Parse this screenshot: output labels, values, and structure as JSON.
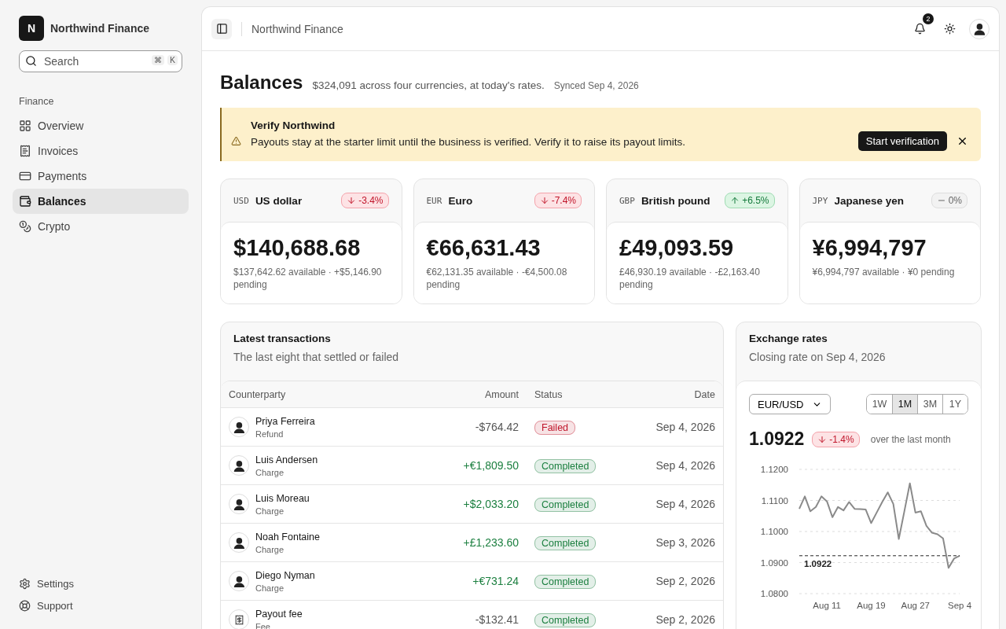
{
  "sidebar": {
    "brand": {
      "initial": "N",
      "name": "Northwind Finance"
    },
    "search": {
      "placeholder": "Search",
      "keys": [
        "⌘",
        "K"
      ]
    },
    "section": "Finance",
    "items": [
      {
        "label": "Overview",
        "selected": false
      },
      {
        "label": "Invoices",
        "selected": false
      },
      {
        "label": "Payments",
        "selected": false
      },
      {
        "label": "Balances",
        "selected": true
      },
      {
        "label": "Crypto",
        "selected": false
      }
    ],
    "footer": [
      {
        "label": "Settings"
      },
      {
        "label": "Support"
      }
    ]
  },
  "topbar": {
    "title": "Northwind Finance",
    "notifications": "2"
  },
  "page": {
    "title": "Balances",
    "summary": "$324,091 across four currencies, at today's rates.",
    "synced": "Synced Sep 4, 2026"
  },
  "alert": {
    "title": "Verify Northwind",
    "message": "Payouts stay at the starter limit until the business is verified. Verify it to raise its payout limits.",
    "action": "Start verification"
  },
  "balances": [
    {
      "code": "USD",
      "name": "US dollar",
      "change": {
        "label": "-3.4%",
        "kind": "down"
      },
      "amount": "$140,688.68",
      "detail": "$137,642.62 available · +$5,146.90 pending"
    },
    {
      "code": "EUR",
      "name": "Euro",
      "change": {
        "label": "-7.4%",
        "kind": "down"
      },
      "amount": "€66,631.43",
      "detail": "€62,131.35 available · -€4,500.08 pending"
    },
    {
      "code": "GBP",
      "name": "British pound",
      "change": {
        "label": "+6.5%",
        "kind": "up"
      },
      "amount": "£49,093.59",
      "detail": "£46,930.19 available · -£2,163.40 pending"
    },
    {
      "code": "JPY",
      "name": "Japanese yen",
      "change": {
        "label": "0%",
        "kind": "flat"
      },
      "amount": "¥6,994,797",
      "detail": "¥6,994,797 available · ¥0 pending"
    }
  ],
  "transactions": {
    "title": "Latest transactions",
    "subtitle": "The last eight that settled or failed",
    "columns": [
      "Counterparty",
      "Amount",
      "Status",
      "Date"
    ],
    "rows": [
      {
        "kind": "refund",
        "name": "Priya Ferreira",
        "type": "Refund",
        "amount": "-$764.42",
        "status": {
          "label": "Failed",
          "color": "#c0162b"
        },
        "date": "Sep 4, 2026"
      },
      {
        "kind": "charge",
        "name": "Luis Andersen",
        "type": "Charge",
        "amount": "+€1,809.50",
        "status": {
          "label": "Completed",
          "color": "#1b7f3f"
        },
        "date": "Sep 4, 2026"
      },
      {
        "kind": "charge",
        "name": "Luis Moreau",
        "type": "Charge",
        "amount": "+$2,033.20",
        "status": {
          "label": "Completed",
          "color": "#1b7f3f"
        },
        "date": "Sep 4, 2026"
      },
      {
        "kind": "charge",
        "name": "Noah Fontaine",
        "type": "Charge",
        "amount": "+£1,233.60",
        "status": {
          "label": "Completed",
          "color": "#1b7f3f"
        },
        "date": "Sep 3, 2026"
      },
      {
        "kind": "charge",
        "name": "Diego Nyman",
        "type": "Charge",
        "amount": "+€731.24",
        "status": {
          "label": "Completed",
          "color": "#1b7f3f"
        },
        "date": "Sep 2, 2026"
      },
      {
        "kind": "fee",
        "name": "Payout fee",
        "type": "Fee",
        "amount": "-$132.41",
        "status": {
          "label": "Completed",
          "color": "#1b7f3f"
        },
        "date": "Sep 2, 2026"
      }
    ]
  },
  "rates": {
    "title": "Exchange rates",
    "subtitle": "Closing rate on Sep 4, 2026",
    "pair": "EUR/USD",
    "ranges": [
      {
        "label": "1W",
        "selected": false
      },
      {
        "label": "1M",
        "selected": true
      },
      {
        "label": "3M",
        "selected": false
      },
      {
        "label": "1Y",
        "selected": false
      }
    ],
    "value": "1.0922",
    "change": {
      "label": "-1.4%",
      "kind": "down"
    },
    "period": "over the last month",
    "chart_data": {
      "type": "line",
      "grid": true,
      "categories": [
        null,
        null,
        null,
        null,
        null,
        "Aug 11",
        null,
        null,
        null,
        null,
        null,
        null,
        null,
        "Aug 19",
        null,
        null,
        null,
        null,
        null,
        null,
        null,
        "Aug 27",
        null,
        null,
        null,
        null,
        null,
        null,
        null,
        "Sep 4"
      ],
      "series": [
        {
          "color": "#8a8a8a",
          "line_style": "solid",
          "values": [
            1.1073,
            1.1113,
            1.1065,
            1.1079,
            1.1113,
            1.1097,
            1.1046,
            1.1079,
            1.1068,
            1.1095,
            1.1073,
            1.1072,
            1.1071,
            1.1027,
            1.1061,
            1.1095,
            1.1126,
            1.1089,
            1.0976,
            1.1065,
            1.1155,
            1.1061,
            1.1065,
            1.1018,
            1.0996,
            1.0991,
            1.0978,
            1.0883,
            1.0913,
            1.0922
          ]
        },
        {
          "name": "1.0922",
          "color": "#222222",
          "line_style": "dashed",
          "values": [
            1.0922,
            1.0922,
            1.0922,
            1.0922,
            1.0922,
            1.0922,
            1.0922,
            1.0922,
            1.0922,
            1.0922,
            1.0922,
            1.0922,
            1.0922,
            1.0922,
            1.0922,
            1.0922,
            1.0922,
            1.0922,
            1.0922,
            1.0922,
            1.0922,
            1.0922,
            1.0922,
            1.0922,
            1.0922,
            1.0922,
            1.0922,
            1.0922,
            1.0922,
            1.0922
          ]
        }
      ],
      "ylim": [
        1.08,
        1.12
      ],
      "yticks": [
        {
          "value": 1.12,
          "label": "1.1200"
        },
        {
          "value": 1.11,
          "label": "1.1100"
        },
        {
          "value": 1.1,
          "label": "1.1000"
        },
        {
          "value": 1.09,
          "label": "1.0900"
        },
        {
          "value": 1.08,
          "label": "1.0800"
        }
      ]
    }
  }
}
